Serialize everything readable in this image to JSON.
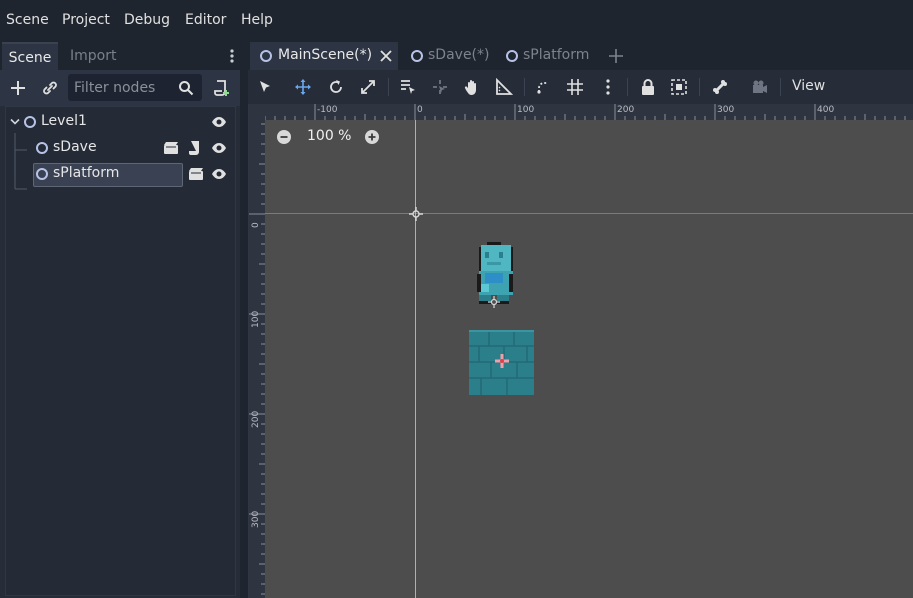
{
  "menubar": {
    "items": [
      "Scene",
      "Project",
      "Debug",
      "Editor",
      "Help"
    ]
  },
  "dock": {
    "tabs": [
      "Scene",
      "Import"
    ],
    "active_tab": "Scene",
    "filter_placeholder": "Filter nodes"
  },
  "scene_tree": {
    "nodes": [
      {
        "label": "Level1",
        "level": 0,
        "expanded": true,
        "icons": [
          "visibility-icon"
        ]
      },
      {
        "label": "sDave",
        "level": 1,
        "icons": [
          "instance-icon",
          "script-icon",
          "visibility-icon"
        ]
      },
      {
        "label": "sPlatform",
        "level": 1,
        "selected": true,
        "icons": [
          "instance-icon",
          "visibility-icon"
        ]
      }
    ]
  },
  "editor_tabs": [
    {
      "label": "MainScene(*)",
      "active": true
    },
    {
      "label": "sDave(*)",
      "active": false
    },
    {
      "label": "sPlatform",
      "active": false
    }
  ],
  "viewport_toolbar": {
    "tools": [
      "select-icon",
      "move-icon",
      "rotate-icon",
      "scale-icon",
      "list-select-icon",
      "pivot-icon",
      "pan-icon",
      "ruler-icon",
      "smart-snap-icon",
      "grid-snap-icon",
      "more-icon",
      "lock-icon",
      "group-icon",
      "bone-icon",
      "camera-icon"
    ],
    "view_label": "View"
  },
  "viewport": {
    "zoom_label": "100 %",
    "h_ruler_labels": [
      "-100",
      "0",
      "100",
      "200",
      "300",
      "400"
    ],
    "v_ruler_labels": [
      "0",
      "100",
      "200",
      "300"
    ],
    "colors": {
      "background": "#4d4d4d",
      "x_axis": "#d0507a",
      "y_axis": "#8fcf6a",
      "platform": "#2b7f8b"
    }
  }
}
